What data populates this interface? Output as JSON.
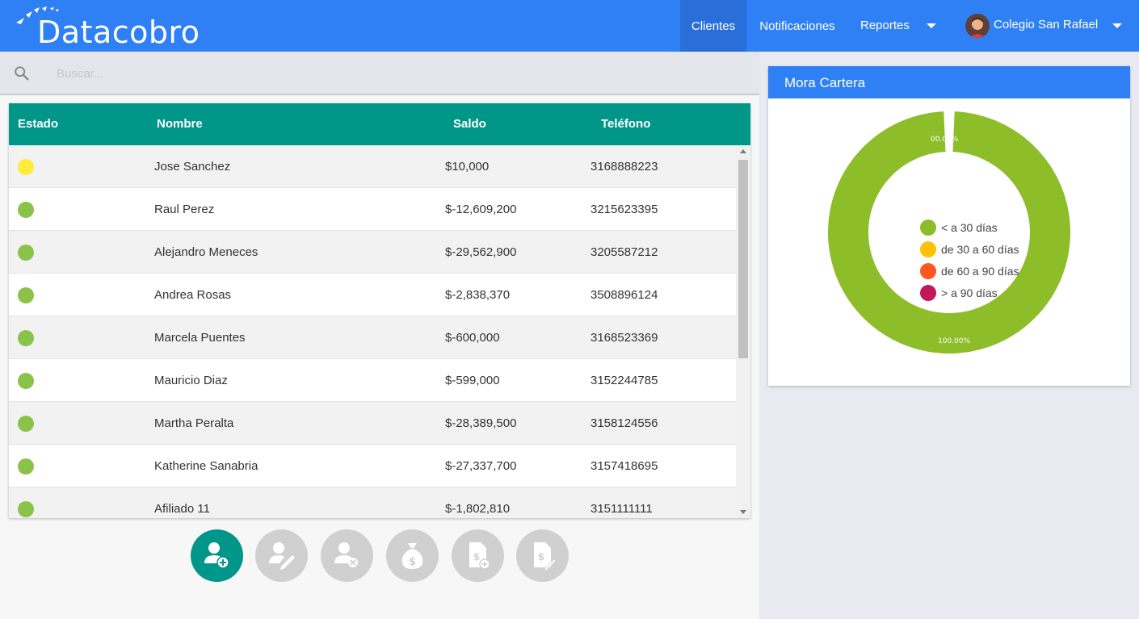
{
  "app": {
    "logo_text_a": "Data",
    "logo_text_b": "cobro"
  },
  "nav": {
    "clientes": "Clientes",
    "notificaciones": "Notificaciones",
    "reportes": "Reportes",
    "user_name": "Colegio San Rafael"
  },
  "search": {
    "placeholder": "Buscar..."
  },
  "table": {
    "headers": {
      "estado": "Estado",
      "nombre": "Nombre",
      "saldo": "Saldo",
      "telefono": "Teléfono"
    },
    "rows": [
      {
        "status_color": "#ffeb3b",
        "nombre": "Jose Sanchez",
        "saldo": "$10,000",
        "telefono": "3168888223"
      },
      {
        "status_color": "#8bc34a",
        "nombre": "Raul Perez",
        "saldo": "$-12,609,200",
        "telefono": "3215623395"
      },
      {
        "status_color": "#8bc34a",
        "nombre": "Alejandro Meneces",
        "saldo": "$-29,562,900",
        "telefono": "3205587212"
      },
      {
        "status_color": "#8bc34a",
        "nombre": "Andrea Rosas",
        "saldo": "$-2,838,370",
        "telefono": "3508896124"
      },
      {
        "status_color": "#8bc34a",
        "nombre": "Marcela Puentes",
        "saldo": "$-600,000",
        "telefono": "3168523369"
      },
      {
        "status_color": "#8bc34a",
        "nombre": "Mauricio Diaz",
        "saldo": "$-599,000",
        "telefono": "3152244785"
      },
      {
        "status_color": "#8bc34a",
        "nombre": "Martha Peralta",
        "saldo": "$-28,389,500",
        "telefono": "3158124556"
      },
      {
        "status_color": "#8bc34a",
        "nombre": "Katherine Sanabria",
        "saldo": "$-27,337,700",
        "telefono": "3157418695"
      },
      {
        "status_color": "#8bc34a",
        "nombre": "Afiliado 11",
        "saldo": "$-1,802,810",
        "telefono": "3151111111"
      }
    ]
  },
  "actions": [
    {
      "name": "add-client-button",
      "icon": "person-add-icon",
      "enabled": true
    },
    {
      "name": "edit-client-button",
      "icon": "person-edit-icon",
      "enabled": false
    },
    {
      "name": "remove-client-button",
      "icon": "person-remove-icon",
      "enabled": false
    },
    {
      "name": "payment-button",
      "icon": "money-bag-icon",
      "enabled": false
    },
    {
      "name": "add-invoice-button",
      "icon": "invoice-add-icon",
      "enabled": false
    },
    {
      "name": "edit-invoice-button",
      "icon": "invoice-edit-icon",
      "enabled": false
    }
  ],
  "chart_card": {
    "title": "Mora Cartera"
  },
  "chart_data": {
    "type": "pie",
    "donut": true,
    "title": "Mora Cartera",
    "categories": [
      "< a 30 días",
      "de 30 a 60 días",
      "de 60 a 90 días",
      "> a 90 días"
    ],
    "values": [
      100,
      0,
      0,
      0
    ],
    "value_labels": [
      "100.00%",
      "00.00%"
    ],
    "colors": [
      "#8ebd2a",
      "#ffc107",
      "#ff5722",
      "#c2185b"
    ],
    "legend_position": "center"
  },
  "colors": {
    "primary": "#2f80f4",
    "teal": "#009688"
  }
}
